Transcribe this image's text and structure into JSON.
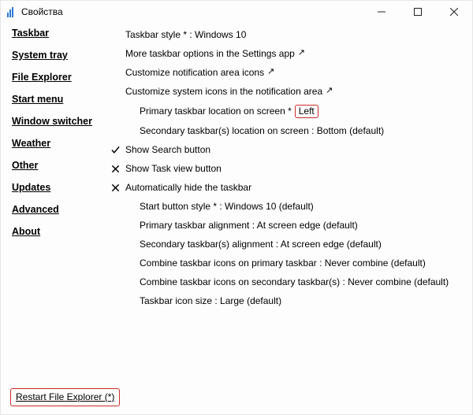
{
  "window": {
    "title": "Свойства"
  },
  "sidebar": {
    "items": [
      "Taskbar",
      "System tray",
      "File Explorer",
      "Start menu",
      "Window switcher",
      "Weather",
      "Other",
      "Updates",
      "Advanced",
      "About"
    ],
    "selected_index": 0
  },
  "content": {
    "taskbar_style": "Taskbar style * : Windows 10",
    "more_options": "More taskbar options in the Settings app",
    "customize_notif_icons": "Customize notification area icons",
    "customize_system_icons": "Customize system icons in the notification area",
    "primary_location_label": "Primary taskbar location on screen *",
    "primary_location_value": "Left",
    "secondary_location": "Secondary taskbar(s) location on screen : Bottom (default)",
    "show_search": "Show Search button",
    "show_taskview": "Show Task view button",
    "auto_hide": "Automatically hide the taskbar",
    "start_button_style": "Start button style * : Windows 10 (default)",
    "primary_alignment": "Primary taskbar alignment : At screen edge (default)",
    "secondary_alignment": "Secondary taskbar(s) alignment : At screen edge (default)",
    "combine_primary": "Combine taskbar icons on primary taskbar : Never combine (default)",
    "combine_secondary": "Combine taskbar icons on secondary taskbar(s) : Never combine (default)",
    "icon_size": "Taskbar icon size : Large (default)"
  },
  "footer": {
    "restart": "Restart File Explorer (*)"
  }
}
